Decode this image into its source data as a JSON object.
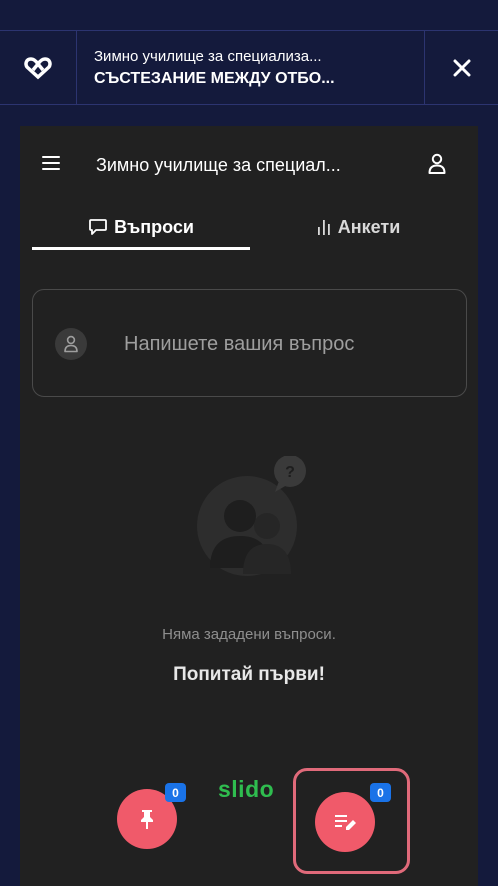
{
  "topbar": {
    "title": "Зимно училище за специализа...",
    "subtitle": "СЪСТЕЗАНИЕ МЕЖДУ ОТБО..."
  },
  "panel": {
    "title": "Зимно училище за специал...",
    "tabs": [
      {
        "label": "Въпроси",
        "active": true
      },
      {
        "label": "Анкети",
        "active": false
      }
    ],
    "ask_placeholder": "Напишете вашия въпрос",
    "empty_text": "Няма зададени въпроси.",
    "empty_cta": "Попитай първи!",
    "brand": "slido",
    "pinned_count": "0",
    "my_questions_count": "0"
  },
  "colors": {
    "background": "#141a3c",
    "panel": "#212121",
    "accent": "#f05a6a",
    "badge": "#1a73e8",
    "brand": "#2fbd4f"
  }
}
